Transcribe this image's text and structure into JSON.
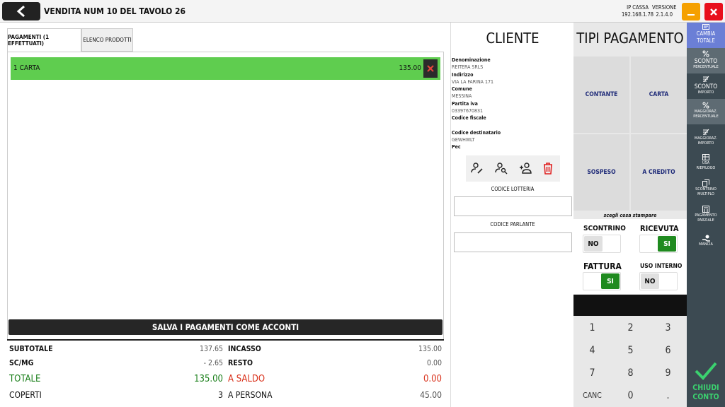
{
  "header": {
    "title": "VENDITA NUM 10 DEL TAVOLO 26",
    "ip_label": "IP CASSA",
    "ip_value": "192.168.1.78",
    "version_label": "VERSIONE",
    "version_value": "2.1.4.0",
    "colors": {
      "minimize": "#f5a000",
      "close": "#e8101c"
    }
  },
  "tabs": [
    {
      "label": "PAGAMENTI (1 EFFETTUATI)",
      "active": true
    },
    {
      "label": "ELENCO PRODOTTI",
      "active": false
    }
  ],
  "payments": [
    {
      "label": "1 CARTA",
      "amount": "135.00"
    }
  ],
  "save_button": "SALVA I PAGAMENTI COME ACCONTI",
  "totals": {
    "subtotale_label": "SUBTOTALE",
    "subtotale": "137.65",
    "scmg_label": "SC/MG",
    "scmg": "- 2.65",
    "totale_label": "TOTALE",
    "totale": "135.00",
    "coperti_label": "COPERTI",
    "coperti": "3",
    "incasso_label": "INCASSO",
    "incasso": "135.00",
    "resto_label": "RESTO",
    "resto": "0.00",
    "asaldo_label": "A SALDO",
    "asaldo": "0.00",
    "apersona_label": "A PERSONA",
    "apersona": "45.00"
  },
  "cliente": {
    "title": "CLIENTE",
    "denominazione_label": "Denominazione",
    "denominazione": "REITERA SRLS",
    "indirizzo_label": "Indirizzo",
    "indirizzo": "VIA LA FARINA 171",
    "comune_label": "Comune",
    "comune": "MESSINA",
    "piva_label": "Partita iva",
    "piva": "03397670831",
    "cf_label": "Codice fiscale",
    "coddest_label": "Codice destinatario",
    "coddest": "GEWHWLT",
    "pec_label": "Pec",
    "lotteria_label": "CODICE LOTTERIA",
    "parlante_label": "CODICE PARLANTE"
  },
  "tipi": {
    "title": "TIPI PAGAMENTO",
    "buttons": [
      "CONTANTE",
      "CARTA",
      "SOSPESO",
      "A CREDITO"
    ],
    "scegli": "scegli cosa stampare",
    "scontrino_label": "SCONTRINO",
    "scontrino_value": "NO",
    "ricevuta_label": "RICEVUTA",
    "ricevuta_value": "SI",
    "fattura_label": "FATTURA",
    "fattura_value": "SI",
    "uso_label": "USO INTERNO",
    "uso_value": "NO"
  },
  "keypad": [
    "1",
    "2",
    "3",
    "4",
    "5",
    "6",
    "7",
    "8",
    "9",
    "CANC",
    "0",
    "."
  ],
  "sidebar": {
    "items": [
      {
        "label": "CAMBIA",
        "label2": "TOTALE"
      },
      {
        "label": "SCONTO",
        "label2": "PERCENTUALE"
      },
      {
        "label": "SCONTO",
        "label2": "IMPORTO"
      },
      {
        "label": "MAGGIORAZ.",
        "label2": "PERCENTUALE"
      },
      {
        "label": "MAGGIORAZ.",
        "label2": "IMPORTO"
      },
      {
        "label": "USA",
        "label2": "RIEPILOGO"
      },
      {
        "label": "SCONTRINO",
        "label2": "MULTIPLO"
      },
      {
        "label": "PAGAMENTO",
        "label2": "PARZIALE"
      },
      {
        "label": "MANCIA",
        "label2": ""
      }
    ],
    "chiudi1": "CHIUDI",
    "chiudi2": "CONTO"
  }
}
